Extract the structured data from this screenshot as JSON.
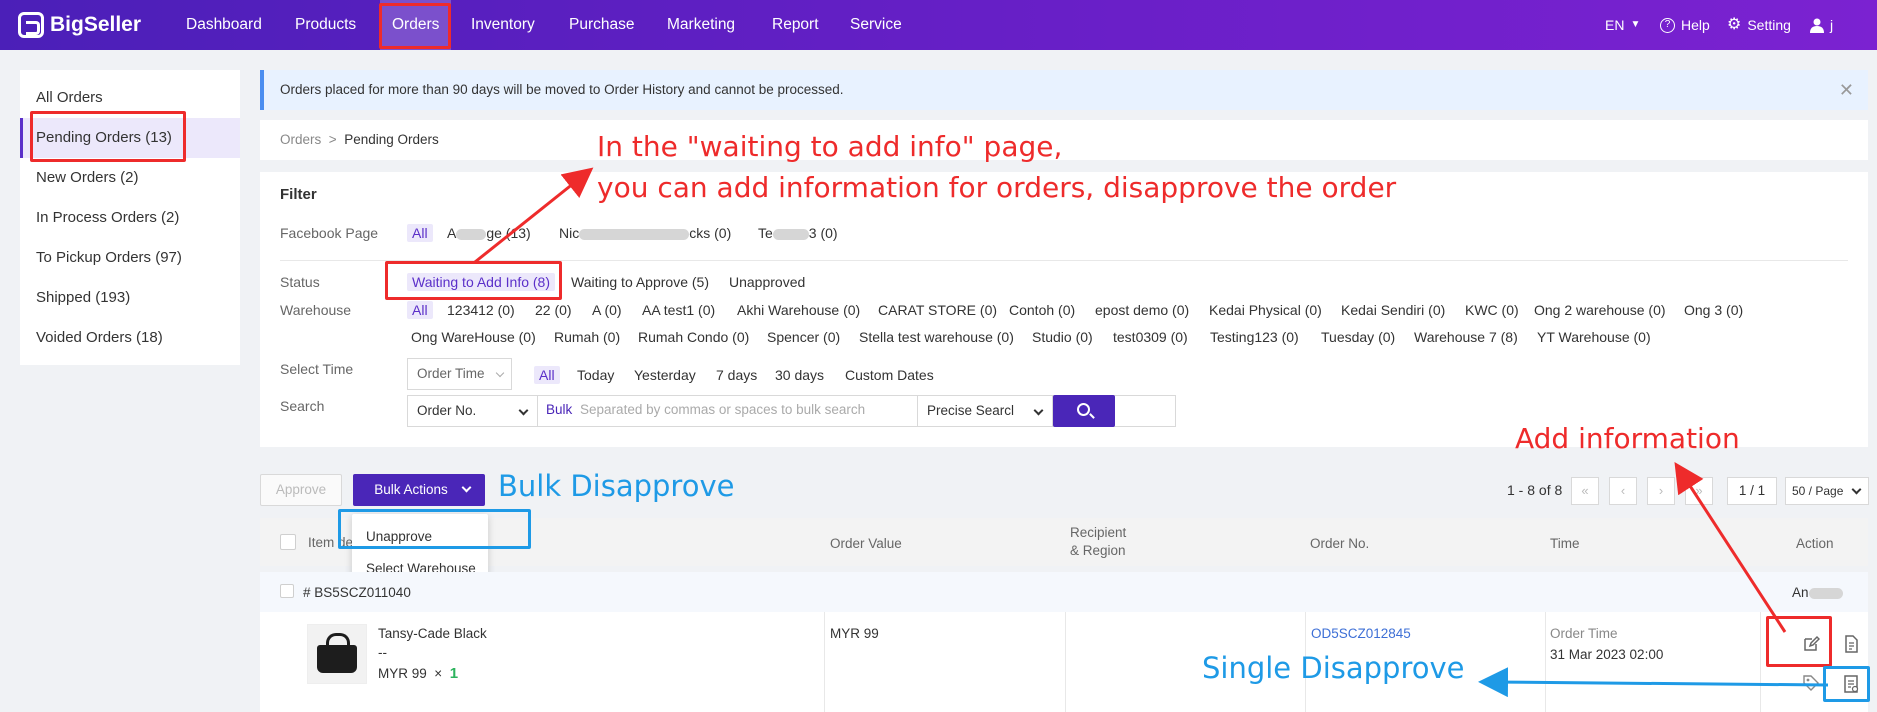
{
  "nav": {
    "brand": "BigSeller",
    "items": [
      {
        "label": "Dashboard"
      },
      {
        "label": "Products"
      },
      {
        "label": "Orders"
      },
      {
        "label": "Inventory"
      },
      {
        "label": "Purchase"
      },
      {
        "label": "Marketing"
      },
      {
        "label": "Report"
      },
      {
        "label": "Service"
      }
    ],
    "language": "EN",
    "help": "Help",
    "setting": "Setting",
    "user": "j"
  },
  "sidebar": {
    "items": [
      {
        "label": "All Orders"
      },
      {
        "label": "Pending Orders (13)"
      },
      {
        "label": "New Orders (2)"
      },
      {
        "label": "In Process Orders (2)"
      },
      {
        "label": "To Pickup Orders (97)"
      },
      {
        "label": "Shipped (193)"
      },
      {
        "label": "Voided Orders (18)"
      }
    ]
  },
  "notice": {
    "text": "Orders placed for more than 90 days will be moved to Order History and cannot be processed.",
    "close": "✕"
  },
  "breadcrumb": {
    "root": "Orders",
    "sep": ">",
    "current": "Pending Orders"
  },
  "filter": {
    "title": "Filter",
    "facebook_label": "Facebook Page",
    "facebook_all": "All",
    "facebook_pages": [
      {
        "pre": "A",
        "post": "ge (13)"
      },
      {
        "pre": "Nic",
        "post": "cks (0)"
      },
      {
        "pre": "Te",
        "post": "3 (0)"
      }
    ],
    "status_label": "Status",
    "status_items": [
      "Waiting to Add Info (8)",
      "Waiting to Approve (5)",
      "Unapproved"
    ],
    "warehouse_label": "Warehouse",
    "warehouse_all": "All",
    "warehouse_row1": [
      "123412 (0)",
      "22 (0)",
      "A (0)",
      "AA test1 (0)",
      "Akhi Warehouse (0)",
      "CARAT STORE (0)",
      "Contoh (0)",
      "epost demo (0)",
      "Kedai Physical (0)",
      "Kedai Sendiri (0)",
      "KWC (0)",
      "Ong 2 warehouse (0)",
      "Ong 3 (0)"
    ],
    "warehouse_row2": [
      "Ong WareHouse (0)",
      "Rumah (0)",
      "Rumah Condo (0)",
      "Spencer (0)",
      "Stella test warehouse (0)",
      "Studio (0)",
      "test0309 (0)",
      "Testing123 (0)",
      "Tuesday (0)",
      "Warehouse 7 (8)",
      "YT Warehouse (0)"
    ],
    "time_label": "Select Time",
    "time_select": "Order Time",
    "time_options": [
      "All",
      "Today",
      "Yesterday",
      "7 days",
      "30 days",
      "Custom Dates"
    ],
    "search_label": "Search",
    "search_field": "Order No.",
    "bulk_label": "Bulk",
    "search_placeholder": "Separated by commas or spaces to bulk search",
    "search_mode": "Precise Searcl"
  },
  "toolbar": {
    "approve": "Approve",
    "bulk_actions": "Bulk Actions",
    "dropdown": [
      "Unapprove",
      "Select Warehouse"
    ],
    "pager_range": "1 - 8 of 8",
    "page": "1 / 1",
    "page_size": "50 / Page",
    "first": "«",
    "prev": "‹",
    "next": "›",
    "last": "»"
  },
  "table": {
    "headers": {
      "item": "Item de",
      "order_value": "Order Value",
      "recipient_1": "Recipient",
      "recipient_2": "& Region",
      "order_no": "Order No.",
      "time": "Time",
      "action": "Action"
    },
    "group": {
      "id": "# BS5SCZ011040",
      "action_prefix": "An"
    },
    "row": {
      "product": "Tansy-Cade Black",
      "variant": "--",
      "price": "MYR 99",
      "times": "×",
      "qty": "1",
      "order_value": "MYR 99",
      "order_no": "OD5SCZ012845",
      "time_label": "Order Time",
      "time_value": "31 Mar 2023 02:00"
    }
  },
  "annotations": {
    "main_line1": "In the \"waiting to add info\" page,",
    "main_line2": "you can add information for orders, disapprove the order",
    "add_info": "Add information",
    "bulk_disapprove": "Bulk Disapprove",
    "single_disapprove": "Single Disapprove"
  },
  "colors": {
    "nav_bg": "#5b21c4",
    "accent": "#4a26b8",
    "annotation_red": "#ee2b2b",
    "annotation_blue": "#1e9ae6"
  }
}
